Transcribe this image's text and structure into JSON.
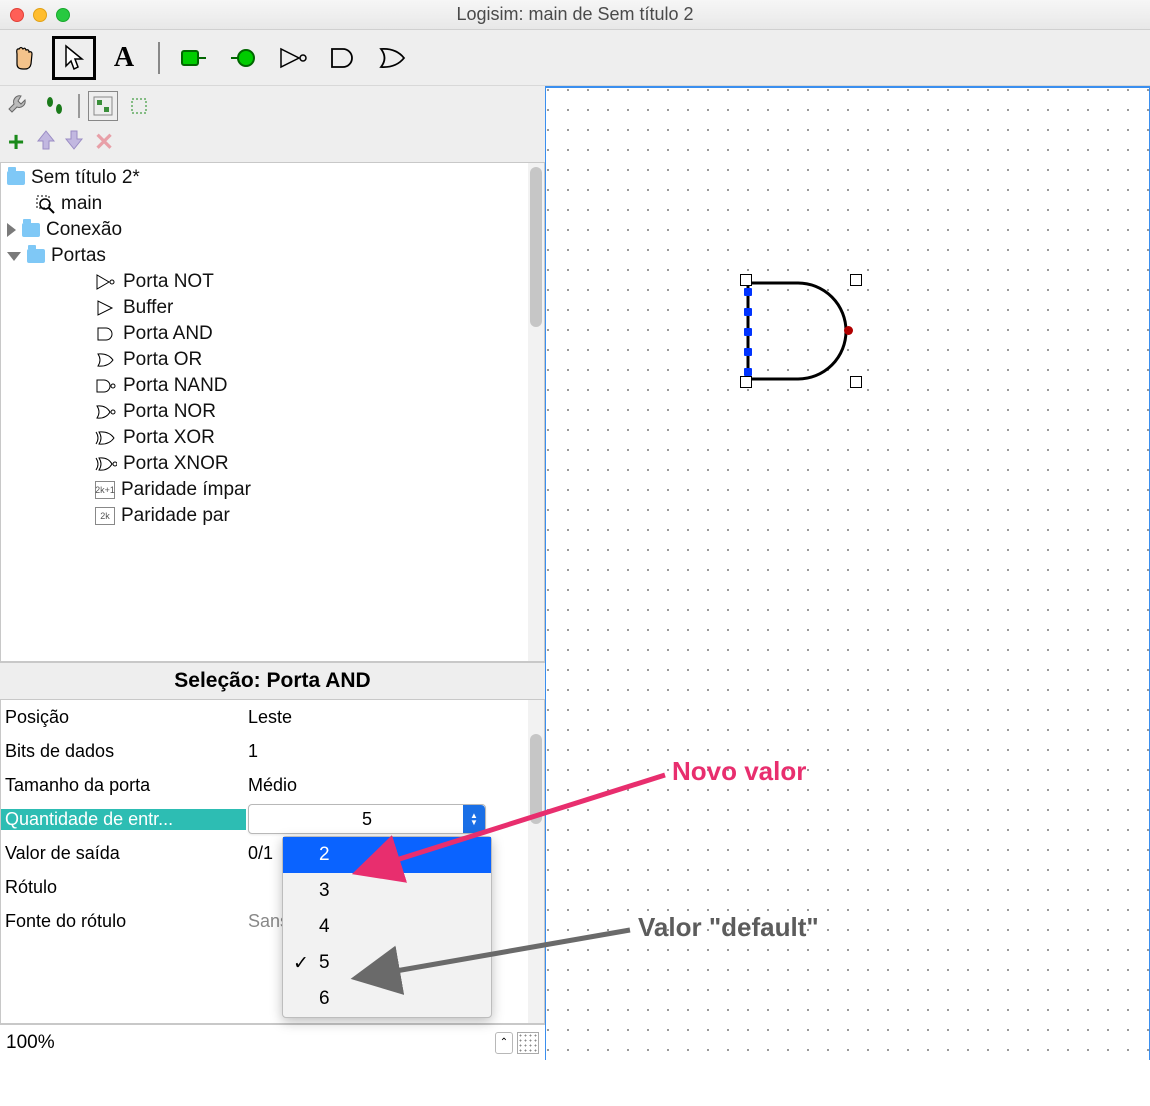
{
  "window": {
    "title": "Logisim: main de Sem título 2"
  },
  "toolbar": {
    "hand": "hand",
    "select": "select",
    "text": "A",
    "pin_in": "pin-input",
    "pin_out": "pin-output",
    "not": "NOT",
    "and": "AND",
    "or": "OR"
  },
  "tree": {
    "project": "Sem título 2*",
    "main": "main",
    "groups": [
      {
        "name": "Conexão",
        "expanded": false
      },
      {
        "name": "Portas",
        "expanded": true,
        "items": [
          "Porta NOT",
          "Buffer",
          "Porta AND",
          "Porta OR",
          "Porta NAND",
          "Porta NOR",
          "Porta XOR",
          "Porta XNOR",
          "Paridade ímpar",
          "Paridade par"
        ]
      }
    ]
  },
  "selection": {
    "title": "Seleção: Porta AND"
  },
  "props": [
    {
      "name": "Posição",
      "value": "Leste"
    },
    {
      "name": "Bits de dados",
      "value": "1"
    },
    {
      "name": "Tamanho da porta",
      "value": "Médio"
    },
    {
      "name": "Quantidade de entr...",
      "value": "5",
      "active": true
    },
    {
      "name": "Valor de saída",
      "value": "0/1"
    },
    {
      "name": "Rótulo",
      "value": ""
    },
    {
      "name": "Fonte do rótulo",
      "value": "SansSerif Normal 12"
    }
  ],
  "dropdown": {
    "highlighted": "2",
    "checked": "5",
    "options": [
      "2",
      "3",
      "4",
      "5",
      "6"
    ]
  },
  "zoom": {
    "level": "100%"
  },
  "annotations": {
    "novo": "Novo valor",
    "default": "Valor \"default\""
  }
}
